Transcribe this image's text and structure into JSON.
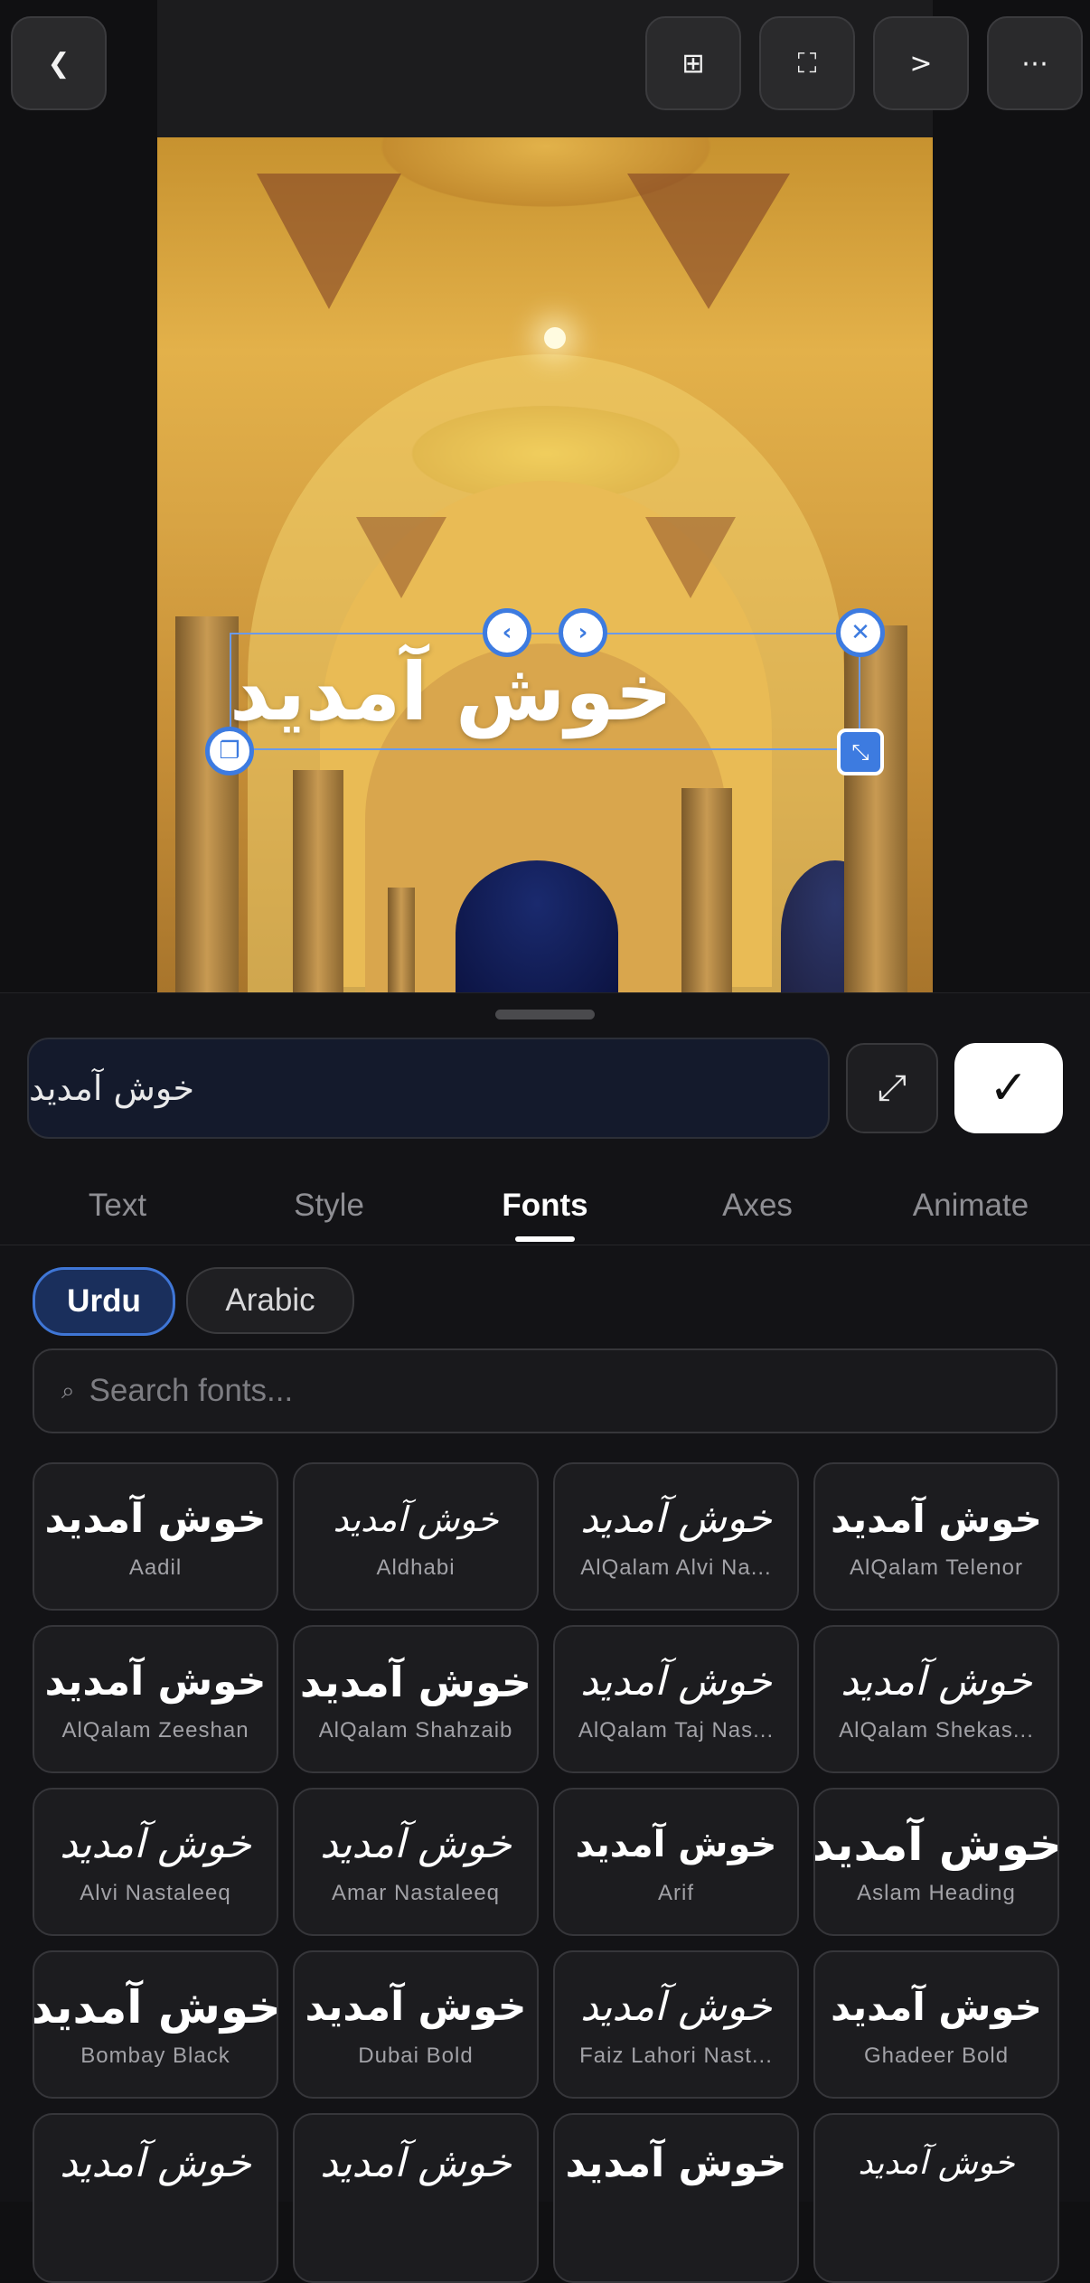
{
  "toolbar": {
    "back_icon": "chevron-left-icon",
    "grid_icon": "grid-icon",
    "fullscreen_icon": "fullscreen-icon",
    "next_label": ">",
    "more_icon": "more-horizontal-icon"
  },
  "canvas": {
    "overlay_text": "خوش آمدید"
  },
  "editor": {
    "text_value": "خوش آمدید",
    "expand_icon": "expand-icon",
    "confirm_icon": "checkmark-icon"
  },
  "tabs": [
    "Text",
    "Style",
    "Fonts",
    "Axes",
    "Animate"
  ],
  "active_tab": "Fonts",
  "language_filters": {
    "urdu": "Urdu",
    "arabic": "Arabic",
    "selected": "Urdu"
  },
  "search": {
    "placeholder": "Search fonts..."
  },
  "fonts": [
    {
      "name": "Aadil",
      "sample": "خوش آمدید"
    },
    {
      "name": "Aldhabi",
      "sample": "خوش آمدید"
    },
    {
      "name": "AlQalam Alvi Na...",
      "sample": "خوش آمدید"
    },
    {
      "name": "AlQalam Telenor",
      "sample": "خوش آمدید"
    },
    {
      "name": "AlQalam Zeeshan",
      "sample": "خوش آمدید"
    },
    {
      "name": "AlQalam Shahzaib",
      "sample": "خوش آمدید"
    },
    {
      "name": "AlQalam Taj Nas...",
      "sample": "خوش آمدید"
    },
    {
      "name": "AlQalam Shekas...",
      "sample": "خوش آمدید"
    },
    {
      "name": "Alvi Nastaleeq",
      "sample": "خوش آمدید"
    },
    {
      "name": "Amar Nastaleeq",
      "sample": "خوش آمدید"
    },
    {
      "name": "Arif",
      "sample": "خوش آمدید"
    },
    {
      "name": "Aslam Heading",
      "sample": "خوش آمدید"
    },
    {
      "name": "Bombay Black",
      "sample": "خوش آمدید"
    },
    {
      "name": "Dubai Bold",
      "sample": "خوش آمدید"
    },
    {
      "name": "Faiz Lahori Nast...",
      "sample": "خوش آمدید"
    },
    {
      "name": "Ghadeer Bold",
      "sample": "خوش آمدید"
    },
    {
      "name": "",
      "sample": "خوش آمدید"
    },
    {
      "name": "",
      "sample": "خوش آمدید"
    },
    {
      "name": "",
      "sample": "خوش آمدید"
    },
    {
      "name": "",
      "sample": "خوش آمدید"
    }
  ],
  "colors": {
    "accent": "#3d7be0",
    "sheet_bg": "#131316",
    "chip_selected_bg": "#1a2f5c"
  }
}
